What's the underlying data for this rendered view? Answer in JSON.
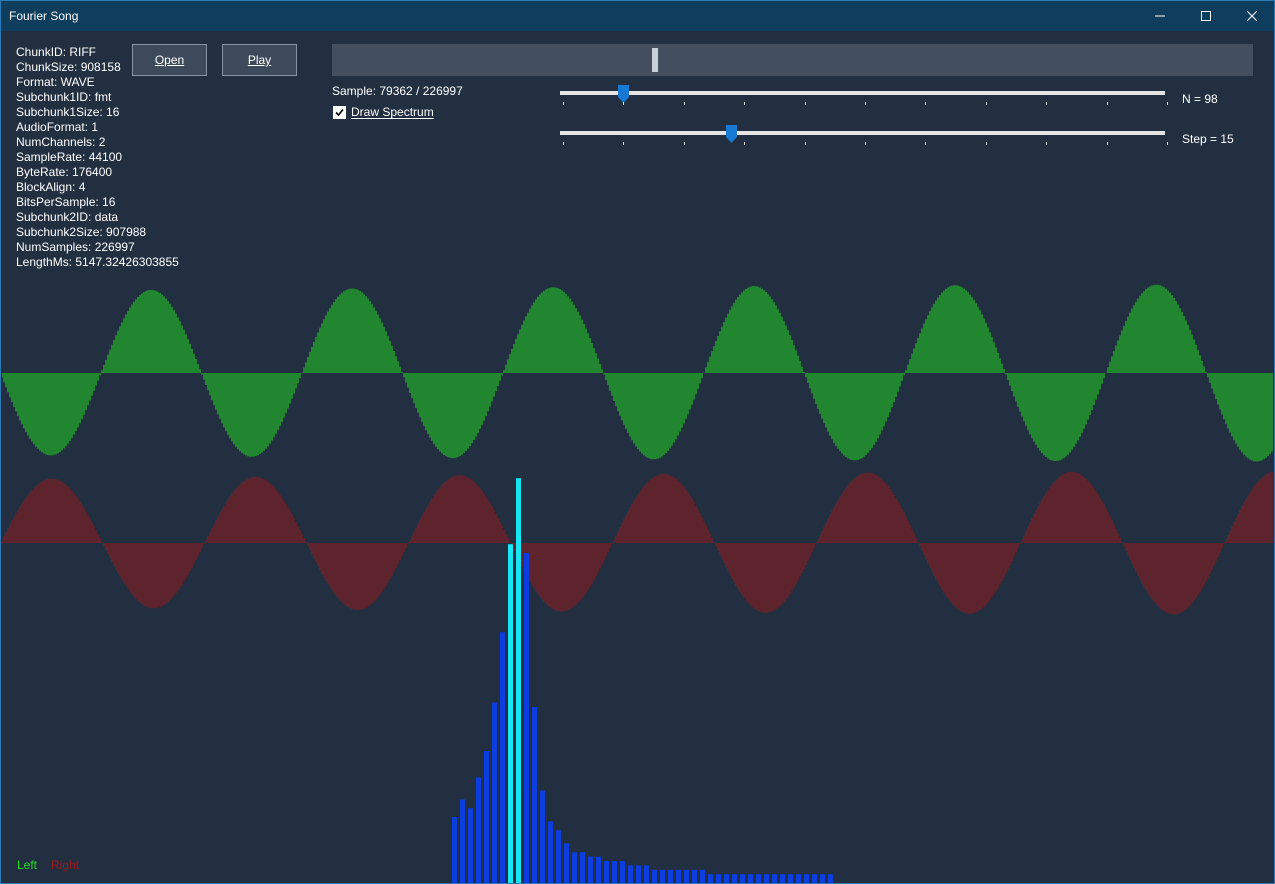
{
  "window": {
    "title": "Fourier Song"
  },
  "header_info": [
    "ChunkID: RIFF",
    "ChunkSize: 908158",
    "Format: WAVE",
    "Subchunk1ID: fmt",
    "Subchunk1Size: 16",
    "AudioFormat: 1",
    "NumChannels: 2",
    "SampleRate: 44100",
    "ByteRate: 176400",
    "BlockAlign: 4",
    "BitsPerSample: 16",
    "Subchunk2ID: data",
    "Subchunk2Size: 907988",
    "NumSamples: 226997",
    "LengthMs: 5147.32426303855"
  ],
  "buttons": {
    "open": "Open",
    "play": "Play"
  },
  "position": {
    "label": "Sample: 79362 / 226997",
    "current": 79362,
    "total": 226997
  },
  "draw_spectrum": {
    "label": "Draw Spectrum",
    "checked": true
  },
  "n_slider": {
    "label": "N = 98",
    "value_fraction": 0.105
  },
  "step_slider": {
    "label": "Step = 15",
    "value_fraction": 0.283
  },
  "legend": {
    "left": "Left",
    "right": "Right"
  },
  "colors": {
    "left": "#22dd22",
    "right": "#9a1a1a",
    "spectrum": "#0b3de0",
    "spectrum_peak": "#19e6f5",
    "thumb": "#1679d4"
  },
  "spectrum": [
    15,
    19,
    17,
    24,
    30,
    41,
    57,
    77,
    92,
    75,
    40,
    21,
    14,
    12,
    9,
    7,
    7,
    6,
    6,
    5,
    5,
    5,
    4,
    4,
    4,
    3,
    3,
    3,
    3,
    3,
    3,
    3,
    2,
    2,
    2,
    2,
    2,
    2,
    2,
    2,
    2,
    2,
    2,
    2,
    2,
    2,
    2,
    2
  ]
}
